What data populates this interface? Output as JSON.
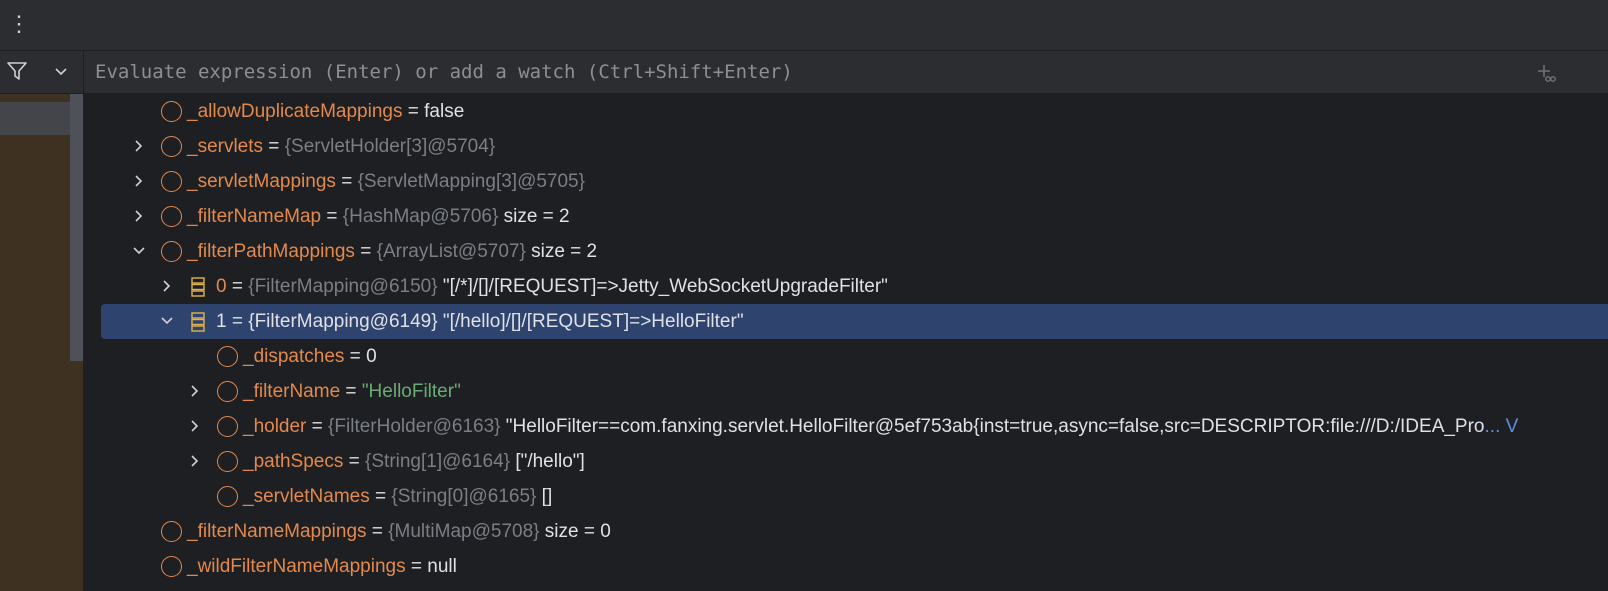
{
  "toolbar": {
    "more_icon": "kebab-icon",
    "more_glyph": "⋮"
  },
  "frames": {
    "filter_icon": "filter-icon",
    "dropdown_icon": "chevron-down-icon"
  },
  "evaluate": {
    "placeholder": "Evaluate expression (Enter) or add a watch (Ctrl+Shift+Enter)",
    "add_icon": "add-watch-icon"
  },
  "colors": {
    "field_name": "#e2894e",
    "type_ref": "#7a7e85",
    "string_value": "#6aab73",
    "selection": "#2e436e",
    "frame_bg": "#3e3122"
  },
  "tree": {
    "rows": [
      {
        "toggle": "none",
        "icon": "field-icon",
        "icon_glyph": "f",
        "name": "_allowDuplicateMappings",
        "eq": " = ",
        "value": "false",
        "type": ""
      },
      {
        "toggle": "collapsed",
        "icon": "field-icon",
        "icon_glyph": "f",
        "name": "_servlets",
        "eq": " = ",
        "type": "{ServletHolder[3]@5704}",
        "value": ""
      },
      {
        "toggle": "collapsed",
        "icon": "field-icon",
        "icon_glyph": "f",
        "name": "_servletMappings",
        "eq": " = ",
        "type": "{ServletMapping[3]@5705}",
        "value": ""
      },
      {
        "toggle": "collapsed",
        "icon": "field-icon",
        "icon_glyph": "f",
        "name": "_filterNameMap",
        "eq": " = ",
        "type": "{HashMap@5706}",
        "value": "size = 2"
      },
      {
        "toggle": "expanded",
        "icon": "field-icon",
        "icon_glyph": "f",
        "name": "_filterPathMappings",
        "eq": " = ",
        "type": "{ArrayList@5707}",
        "value": "size = 2"
      },
      {
        "toggle": "collapsed",
        "icon": "array-element-icon",
        "name": "0",
        "eq": " = ",
        "type": "{FilterMapping@6150}",
        "value": "\"[/*]/[]/[REQUEST]=>Jetty_WebSocketUpgradeFilter\""
      },
      {
        "toggle": "expanded",
        "icon": "array-element-icon",
        "name": "1",
        "eq": " = ",
        "type": "{FilterMapping@6149}",
        "value": "\"[/hello]/[]/[REQUEST]=>HelloFilter\"",
        "selected": true
      },
      {
        "toggle": "none",
        "icon": "field-icon",
        "icon_glyph": "f",
        "name": "_dispatches",
        "eq": " = ",
        "value": "0",
        "type": ""
      },
      {
        "toggle": "collapsed",
        "icon": "field-icon",
        "icon_glyph": "f",
        "name": "_filterName",
        "eq": " = ",
        "string": "\"HelloFilter\"",
        "type": "",
        "value": ""
      },
      {
        "toggle": "collapsed",
        "icon": "field-icon",
        "icon_glyph": "f",
        "name": "_holder",
        "eq": " = ",
        "type": "{FilterHolder@6163}",
        "value": "\"HelloFilter==com.fanxing.servlet.HelloFilter@5ef753ab{inst=true,async=false,src=DESCRIPTOR:file:///D:/IDEA_Pro",
        "ellipsis": "... V"
      },
      {
        "toggle": "collapsed",
        "icon": "field-icon",
        "icon_glyph": "f",
        "name": "_pathSpecs",
        "eq": " = ",
        "type": "{String[1]@6164}",
        "value": "[\"/hello\"]"
      },
      {
        "toggle": "none",
        "icon": "field-icon",
        "icon_glyph": "f",
        "name": "_servletNames",
        "eq": " = ",
        "type": "{String[0]@6165}",
        "value": "[]"
      },
      {
        "toggle": "none",
        "icon": "field-icon",
        "icon_glyph": "f",
        "name": "_filterNameMappings",
        "eq": " = ",
        "type": "{MultiMap@5708}",
        "value": "size = 0"
      },
      {
        "toggle": "none",
        "icon": "field-icon",
        "icon_glyph": "f",
        "name": "_wildFilterNameMappings",
        "eq": " = ",
        "value": "null",
        "type": ""
      }
    ]
  }
}
